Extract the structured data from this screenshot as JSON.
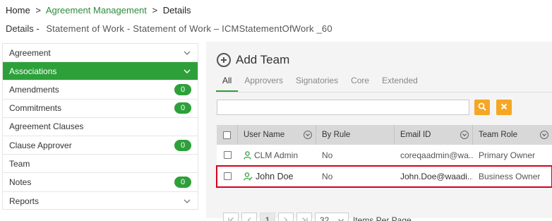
{
  "breadcrumb": {
    "home": "Home",
    "sep1": ">",
    "agreement_management": "Agreement Management",
    "sep2": ">",
    "details": "Details"
  },
  "page_title": {
    "prefix": "Details -",
    "document": "Statement of Work - Statement of Work – ICMStatementOfWork _60"
  },
  "sidebar": {
    "items": [
      {
        "label": "Agreement",
        "badge": null,
        "chevron": true,
        "active": false
      },
      {
        "label": "Associations",
        "badge": null,
        "chevron": true,
        "active": true
      },
      {
        "label": "Amendments",
        "badge": "0",
        "chevron": false,
        "active": false
      },
      {
        "label": "Commitments",
        "badge": "0",
        "chevron": false,
        "active": false
      },
      {
        "label": "Agreement Clauses",
        "badge": null,
        "chevron": false,
        "active": false
      },
      {
        "label": "Clause Approver",
        "badge": "0",
        "chevron": false,
        "active": false
      },
      {
        "label": "Team",
        "badge": null,
        "chevron": false,
        "active": false
      },
      {
        "label": "Notes",
        "badge": "0",
        "chevron": false,
        "active": false
      },
      {
        "label": "Reports",
        "badge": null,
        "chevron": true,
        "active": false
      }
    ]
  },
  "main": {
    "add_team_label": "Add Team",
    "tabs": [
      "All",
      "Approvers",
      "Signatories",
      "Core",
      "Extended"
    ],
    "active_tab": "All",
    "search": {
      "value": "",
      "placeholder": ""
    },
    "grid": {
      "columns": [
        "User Name",
        "By Rule",
        "Email ID",
        "Team Role"
      ],
      "rows": [
        {
          "user_name": "CLM Admin",
          "by_rule": "No",
          "email": "coreqaadmin@wa...",
          "team_role": "Primary Owner",
          "highlighted": false
        },
        {
          "user_name": "John Doe",
          "by_rule": "No",
          "email": "John.Doe@waadi...",
          "team_role": "Business Owner",
          "highlighted": true
        }
      ]
    },
    "pagination": {
      "current_page": "1",
      "per_page": "32",
      "items_per_page_label": "Items Per Page"
    }
  },
  "colors": {
    "accent_green": "#2ea03a",
    "orange": "#f5a623",
    "highlight_red": "#d9001b"
  }
}
